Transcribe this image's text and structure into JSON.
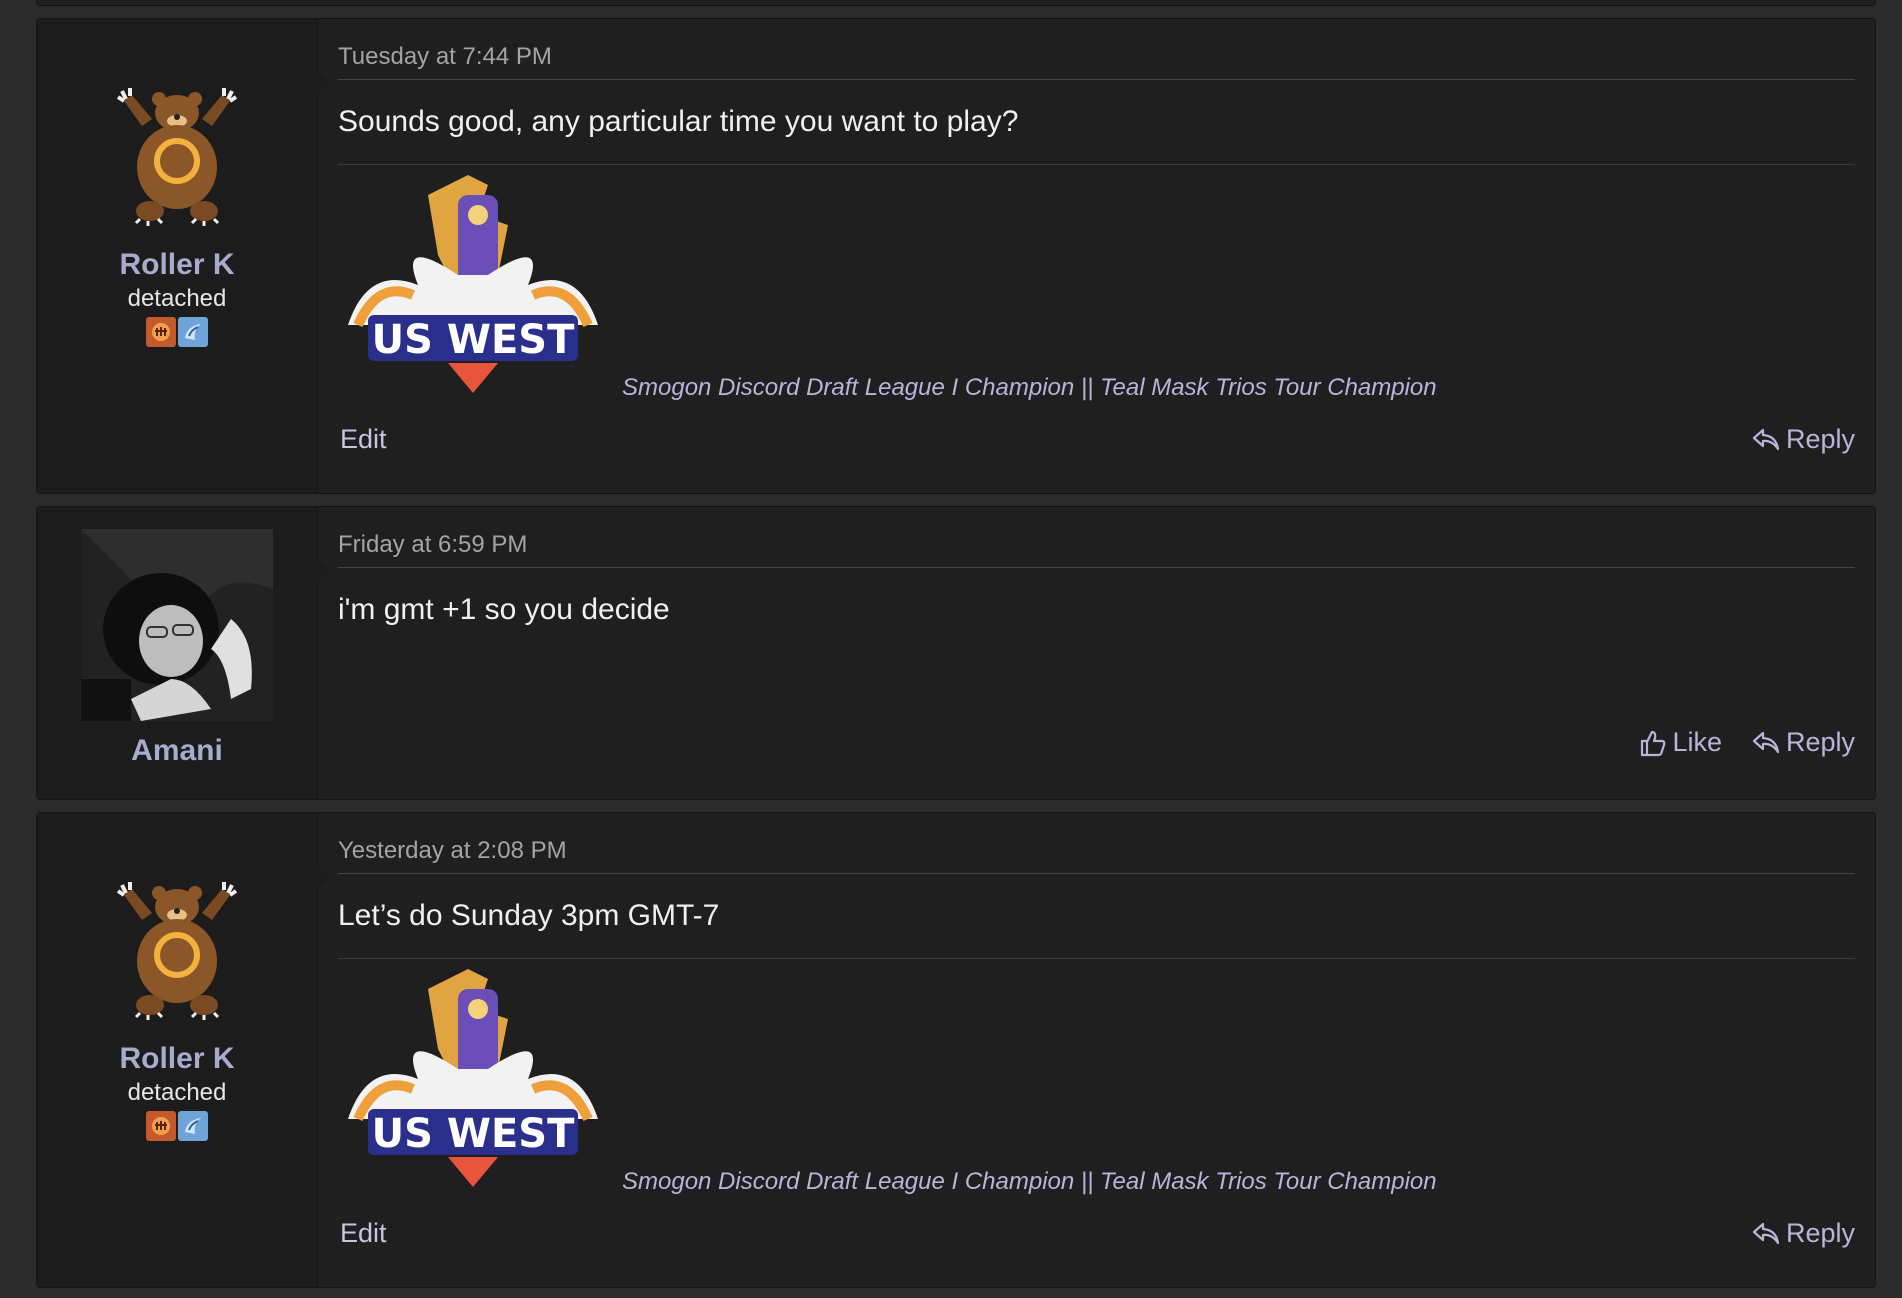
{
  "posts": [
    {
      "author": "Roller K",
      "user_title": "detached",
      "avatar_icon": "ursaring-icon",
      "date": "Tuesday at 7:44 PM",
      "message": "Sounds good, any particular time you want to play?",
      "signature_logo_text": "US WEST",
      "signature": "Smogon Discord Draft League I Champion || Teal Mask Trios Tour Champion",
      "actions_left": "Edit",
      "actions_right": [
        "Reply"
      ]
    },
    {
      "author": "Amani",
      "user_title": "",
      "avatar_icon": "profile-photo",
      "date": "Friday at 6:59 PM",
      "message": "i'm gmt +1 so you decide",
      "actions_right": [
        "Like",
        "Reply"
      ]
    },
    {
      "author": "Roller K",
      "user_title": "detached",
      "avatar_icon": "ursaring-icon",
      "date": "Yesterday at 2:08 PM",
      "message": "Let’s do Sunday 3pm GMT-7",
      "signature_logo_text": "US WEST",
      "signature": "Smogon Discord Draft League I Champion || Teal Mask Trios Tour Champion",
      "actions_left": "Edit",
      "actions_right": [
        "Reply"
      ]
    }
  ],
  "colors": {
    "background": "#2b2b2b",
    "post_bg": "#1f1f1f",
    "username": "#aaaacd",
    "signature": "#b7b5d9",
    "action": "#b8b6d8"
  }
}
